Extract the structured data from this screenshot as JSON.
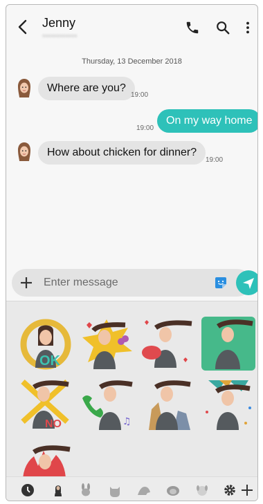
{
  "header": {
    "contact_name": "Jenny",
    "contact_sub": "••••••••••••",
    "icons": [
      "back-arrow-icon",
      "phone-icon",
      "search-icon",
      "more-vertical-icon"
    ]
  },
  "chat": {
    "date": "Thursday, 13 December 2018",
    "messages": [
      {
        "direction": "incoming",
        "text": "Where are you?",
        "time": "19:00"
      },
      {
        "direction": "outgoing",
        "text": "On my way home",
        "time": "19:00"
      },
      {
        "direction": "incoming",
        "text": "How about chicken for dinner?",
        "time": "19:00"
      }
    ]
  },
  "composer": {
    "placeholder": "Enter message"
  },
  "sticker_panel": {
    "sticker_count": 9,
    "selected_index": 3,
    "tabs": [
      "recent-icon",
      "avatar-icon",
      "bunny-icon",
      "cat-icon",
      "bird-icon",
      "hedgehog-icon",
      "dog-icon",
      "settings-icon",
      "add-icon"
    ]
  },
  "colors": {
    "accent": "#2ec1b9",
    "incoming_bubble": "#e4e4e4",
    "selected_sticker": "#46b98a"
  }
}
